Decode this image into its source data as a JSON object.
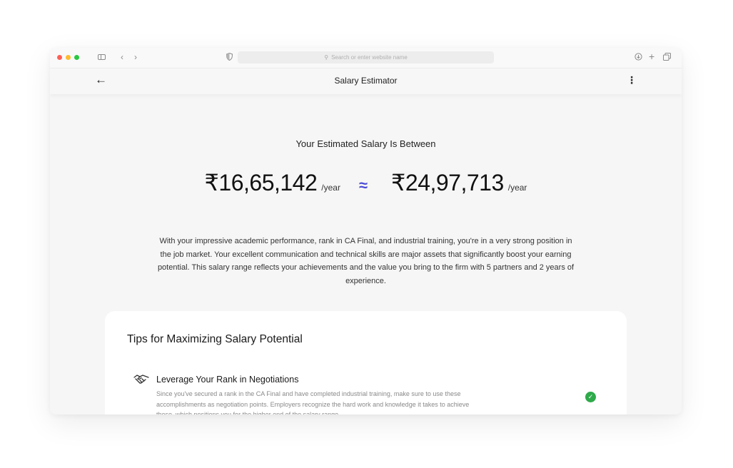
{
  "browser": {
    "url_placeholder": "Search or enter website name",
    "icons": [
      "sidebar-icon",
      "back-icon",
      "forward-icon",
      "shield-icon",
      "search-icon",
      "download-icon",
      "plus-icon",
      "tabs-icon"
    ]
  },
  "appbar": {
    "title": "Salary Estimator",
    "back_glyph": "←",
    "menu_glyph": "⋮"
  },
  "estimate": {
    "headline": "Your Estimated Salary Is Between",
    "min_amount": "₹16,65,142",
    "max_amount": "₹24,97,713",
    "per_label": "/year",
    "approx_symbol": "≈",
    "description": "With your impressive academic performance, rank in CA Final, and industrial training, you're in a very strong position in the job market. Your excellent communication and technical skills are major assets that significantly boost your earning potential. This salary range reflects your achievements and the value you bring to the firm with 5 partners and 2 years of experience."
  },
  "tips": {
    "title": "Tips for Maximizing Salary Potential",
    "items": [
      {
        "heading": "Leverage Your Rank in Negotiations",
        "text": "Since you've secured a rank in the CA Final and have completed industrial training, make sure to use these accomplishments as negotiation points. Employers recognize the hard work and knowledge it takes to achieve these, which positions you for the higher end of the salary range.",
        "icon": "handshake-icon",
        "status": "check"
      }
    ]
  },
  "colors": {
    "accent": "#4b4bd6",
    "success": "#2eaa4a",
    "background": "#f6f6f6"
  }
}
